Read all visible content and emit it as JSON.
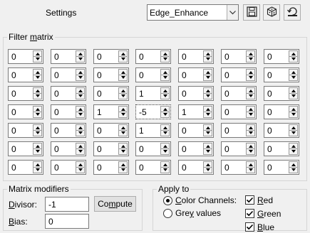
{
  "header": {
    "title": "Settings",
    "preset_value": "Edge_Enhance",
    "save_icon": "save-icon",
    "random_icon": "dice-icon",
    "reset_icon": "reset-icon"
  },
  "filter_matrix": {
    "label": "Filter matrix",
    "rows": [
      [
        "0",
        "0",
        "0",
        "0",
        "0",
        "0",
        "0"
      ],
      [
        "0",
        "0",
        "0",
        "0",
        "0",
        "0",
        "0"
      ],
      [
        "0",
        "0",
        "0",
        "1",
        "0",
        "0",
        "0"
      ],
      [
        "0",
        "0",
        "1",
        "-5",
        "1",
        "0",
        "0"
      ],
      [
        "0",
        "0",
        "0",
        "1",
        "0",
        "0",
        "0"
      ],
      [
        "0",
        "0",
        "0",
        "0",
        "0",
        "0",
        "0"
      ],
      [
        "0",
        "0",
        "0",
        "0",
        "0",
        "0",
        "0"
      ]
    ]
  },
  "matrix_modifiers": {
    "label": "Matrix modifiers",
    "divisor_label": "Divisor:",
    "divisor_value": "-1",
    "bias_label": "Bias:",
    "bias_value": "0",
    "compute_label": "Compute"
  },
  "apply_to": {
    "label": "Apply to",
    "color_channels_label": "Color Channels:",
    "grey_values_label": "Grey values",
    "selected": "color_channels",
    "red_label": "Red",
    "green_label": "Green",
    "blue_label": "Blue",
    "red_checked": true,
    "green_checked": true,
    "blue_checked": true
  }
}
